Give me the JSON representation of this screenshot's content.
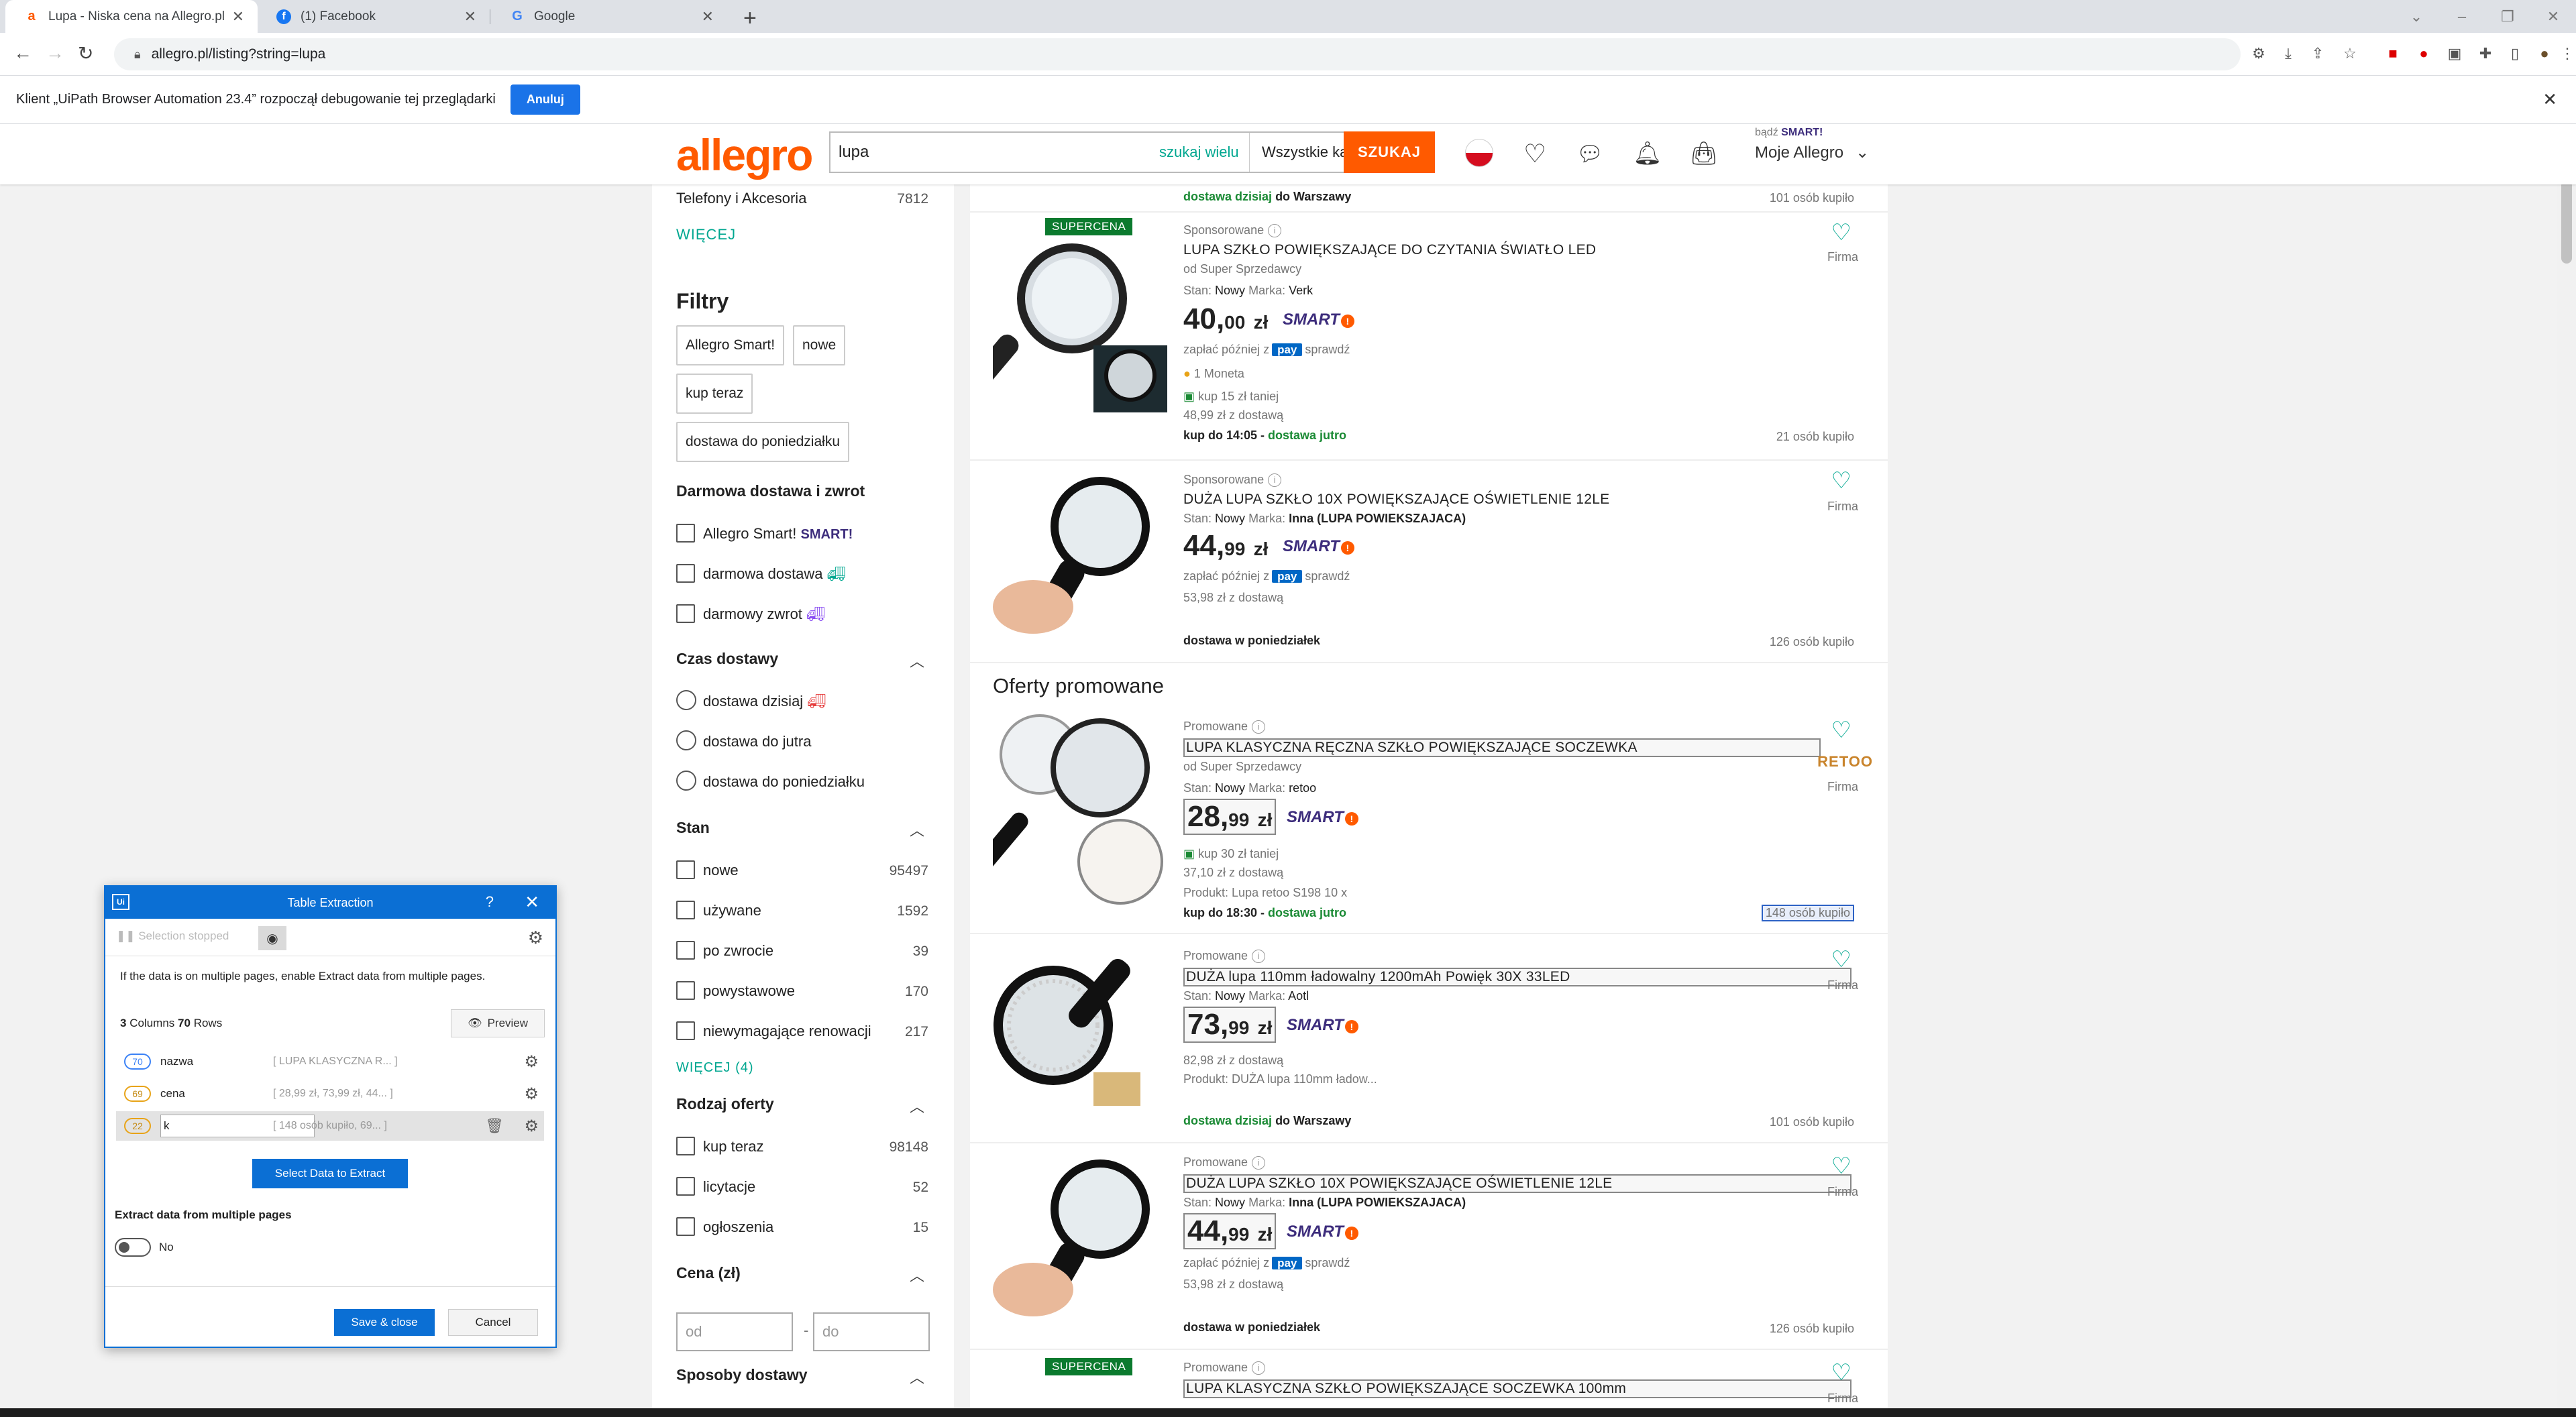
{
  "browser": {
    "tabs": [
      {
        "label": "Lupa - Niska cena na Allegro.pl",
        "favicon": "a"
      },
      {
        "label": "(1) Facebook",
        "favicon": "f"
      },
      {
        "label": "Google",
        "favicon": "G"
      }
    ],
    "url": "allegro.pl/listing?string=lupa",
    "infobar_text": "Klient „UiPath Browser Automation 23.4” rozpoczął debugowanie tej przeglądarki",
    "infobar_button": "Anuluj"
  },
  "header": {
    "logo": "allegro",
    "search_value": "lupa",
    "multi_search": "szukaj wielu",
    "category": "Wszystkie kategorie",
    "search_button": "SZUKAJ",
    "account_prefix": "bądź",
    "account_smart": "SMART!",
    "account_label": "Moje Allegro"
  },
  "sidebar": {
    "top_category": "Telefony i Akcesoria",
    "top_category_count": "7812",
    "more_link": "WIĘCEJ",
    "filters_heading": "Filtry",
    "active_filters": [
      "Allegro Smart!",
      "nowe",
      "kup teraz",
      "dostawa do poniedziałku"
    ],
    "free_delivery_heading": "Darmowa dostawa i zwrot",
    "free_delivery_options": [
      "Allegro Smart!",
      "darmowa dostawa",
      "darmowy zwrot"
    ],
    "delivery_time_heading": "Czas dostawy",
    "delivery_time_options": [
      "dostawa dzisiaj",
      "dostawa do jutra",
      "dostawa do poniedziałku"
    ],
    "condition_heading": "Stan",
    "condition_options": [
      {
        "label": "nowe",
        "count": "95497"
      },
      {
        "label": "używane",
        "count": "1592"
      },
      {
        "label": "po zwrocie",
        "count": "39"
      },
      {
        "label": "powystawowe",
        "count": "170"
      },
      {
        "label": "niewymagające renowacji",
        "count": "217"
      }
    ],
    "condition_more": "WIĘCEJ (4)",
    "offer_type_heading": "Rodzaj oferty",
    "offer_type_options": [
      {
        "label": "kup teraz",
        "count": "98148"
      },
      {
        "label": "licytacje",
        "count": "52"
      },
      {
        "label": "ogłoszenia",
        "count": "15"
      }
    ],
    "price_heading": "Cena (zł)",
    "price_from": "od",
    "price_to": "do",
    "price_sep": "-",
    "shipping_heading": "Sposoby dostawy"
  },
  "listing": {
    "top_delivery": "dostawa dzisiaj",
    "top_delivery_suffix": "do Warszawy",
    "top_bought": "101 osób kupiło",
    "promo_heading": "Oferty promowane",
    "products": [
      {
        "badge": "SUPERCENA",
        "label": "Sponsorowane",
        "title": "LUPA SZKŁO POWIĘKSZAJĄCE DO CZYTANIA ŚWIATŁO LED",
        "seller": "od  Super Sprzedawcy",
        "condition": "Nowy",
        "brand": "Verk",
        "price_int": "40,",
        "price_dec": "00",
        "currency": "zł",
        "pay_later": "zapłać później z",
        "pay_check": "sprawdź",
        "coin": "1 Moneta",
        "cheaper": "kup 15 zł taniej",
        "with_delivery": "48,99 zł z dostawą",
        "deadline": "kup do 14:05 - ",
        "delivery": "dostawa jutro",
        "bought": "21 osób kupiło",
        "firma": "Firma"
      },
      {
        "label": "Sponsorowane",
        "title": "DUŻA LUPA SZKŁO 10X POWIĘKSZAJĄCE OŚWIETLENIE 12LE",
        "condition": "Nowy",
        "brand": "Inna (LUPA POWIEKSZAJACA)",
        "price_int": "44,",
        "price_dec": "99",
        "currency": "zł",
        "pay_later": "zapłać później z",
        "pay_check": "sprawdź",
        "with_delivery": "53,98 zł z dostawą",
        "delivery": "dostawa w poniedziałek",
        "bought": "126 osób kupiło",
        "firma": "Firma"
      },
      {
        "label": "Promowane",
        "title": "LUPA KLASYCZNA RĘCZNA SZKŁO POWIĘKSZAJĄCE SOCZEWKA",
        "seller": "od  Super Sprzedawcy",
        "condition": "Nowy",
        "brand": "retoo",
        "price_int": "28,",
        "price_dec": "99",
        "currency": "zł",
        "cheaper": "kup 30 zł taniej",
        "with_delivery": "37,10 zł z dostawą",
        "product": "Produkt: Lupa retoo S198 10 x",
        "deadline": "kup do 18:30 - ",
        "delivery": "dostawa jutro",
        "bought": "148 osób kupiło",
        "logo": "RETOO",
        "firma": "Firma"
      },
      {
        "label": "Promowane",
        "title": "DUŻA lupa 110mm ładowalny 1200mAh Powięk 30X 33LED",
        "condition": "Nowy",
        "brand": "Aotl",
        "price_int": "73,",
        "price_dec": "99",
        "currency": "zł",
        "with_delivery": "82,98 zł z dostawą",
        "product": "Produkt: DUŻA lupa 110mm ładow...",
        "delivery": "dostawa dzisiaj",
        "delivery_suffix": "do Warszawy",
        "bought": "101 osób kupiło",
        "firma": "Firma"
      },
      {
        "label": "Promowane",
        "title": "DUŻA LUPA SZKŁO 10X POWIĘKSZAJĄCE OŚWIETLENIE 12LE",
        "condition": "Nowy",
        "brand": "Inna (LUPA POWIEKSZAJACA)",
        "price_int": "44,",
        "price_dec": "99",
        "currency": "zł",
        "pay_later": "zapłać później z",
        "pay_check": "sprawdź",
        "with_delivery": "53,98 zł z dostawą",
        "delivery": "dostawa w poniedziałek",
        "bought": "126 osób kupiło",
        "firma": "Firma"
      },
      {
        "badge": "SUPERCENA",
        "label": "Promowane",
        "title": "LUPA KLASYCZNA SZKŁO POWIĘKSZAJĄCE SOCZEWKA 100mm",
        "firma": "Firma"
      }
    ],
    "cond_label": "Stan:",
    "brand_label": "Marka:",
    "smart_label": "SMART",
    "pay_badge": "pay"
  },
  "dialog": {
    "logo": "Ui",
    "title": "Table Extraction",
    "help": "?",
    "status": "Selection stopped",
    "hint": "If the data is on multiple pages, enable Extract data from multiple pages.",
    "columns_count": "3",
    "columns_label": "Columns",
    "rows_count": "70",
    "rows_label": "Rows",
    "preview": "Preview",
    "columns": [
      {
        "count": "70",
        "name": "nazwa",
        "sample": "[ LUPA KLASYCZNA R... ]",
        "color": "#3b82f6"
      },
      {
        "count": "69",
        "name": "cena",
        "sample": "[ 28,99 zł, 73,99 zł, 44... ]",
        "color": "#e8a317"
      },
      {
        "count": "22",
        "name": "k",
        "sample": "[ 148 osób kupiło, 69... ]",
        "color": "#e8a317"
      }
    ],
    "select_button": "Select Data to Extract",
    "multi_heading": "Extract data from multiple pages",
    "toggle_label": "No",
    "save": "Save & close",
    "cancel": "Cancel"
  },
  "colors": {
    "brand": "#ff5a00",
    "accent": "#00a790",
    "uipath_blue": "#0b6fd4",
    "smart": "#3d2d7c"
  }
}
